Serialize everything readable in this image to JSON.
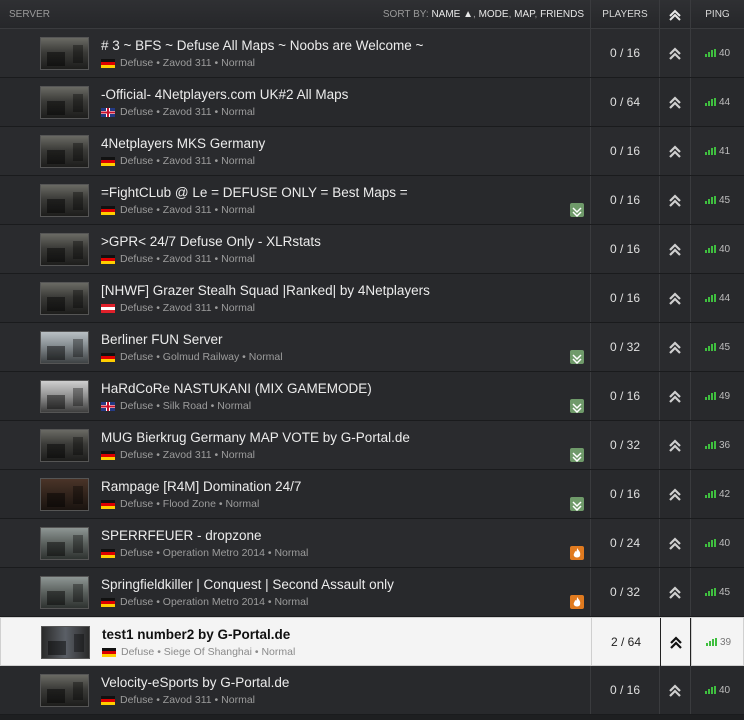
{
  "header": {
    "server": "SERVER",
    "sort_by": "SORT BY:",
    "sort_options": [
      "NAME ▲",
      "MODE",
      "MAP",
      "FRIENDS"
    ],
    "players": "PLAYERS",
    "ping": "PING"
  },
  "colors": {
    "ping_good": "#3fbf3f",
    "selected_bg": "#f4f4f4",
    "badge_green": "#6f9a6a",
    "badge_orange": "#e07a1f"
  },
  "servers": [
    {
      "name": "# 3 ~ BFS ~ Defuse All Maps ~ Noobs are Welcome ~",
      "country": "de",
      "mode": "Defuse",
      "map": "Zavod 311",
      "preset": "Normal",
      "players": "0 / 16",
      "ping": "40",
      "badge": ""
    },
    {
      "name": "-Official- 4Netplayers.com UK#2 All Maps",
      "country": "uk",
      "mode": "Defuse",
      "map": "Zavod 311",
      "preset": "Normal",
      "players": "0 / 64",
      "ping": "44",
      "badge": ""
    },
    {
      "name": "4Netplayers MKS Germany",
      "country": "de",
      "mode": "Defuse",
      "map": "Zavod 311",
      "preset": "Normal",
      "players": "0 / 16",
      "ping": "41",
      "badge": ""
    },
    {
      "name": "=FightCLub @ Le = DEFUSE ONLY = Best Maps =",
      "country": "de",
      "mode": "Defuse",
      "map": "Zavod 311",
      "preset": "Normal",
      "players": "0 / 16",
      "ping": "45",
      "badge": "green"
    },
    {
      "name": ">GPR< 24/7 Defuse Only - XLRstats",
      "country": "de",
      "mode": "Defuse",
      "map": "Zavod 311",
      "preset": "Normal",
      "players": "0 / 16",
      "ping": "40",
      "badge": ""
    },
    {
      "name": "[NHWF] Grazer Stealh Squad |Ranked| by 4Netplayers",
      "country": "at",
      "mode": "Defuse",
      "map": "Zavod 311",
      "preset": "Normal",
      "players": "0 / 16",
      "ping": "44",
      "badge": ""
    },
    {
      "name": "Berliner FUN Server",
      "country": "de",
      "mode": "Defuse",
      "map": "Golmud Railway",
      "preset": "Normal",
      "players": "0 / 32",
      "ping": "45",
      "badge": "green"
    },
    {
      "name": "HaRdCoRe NASTUKANI (MIX GAMEMODE)",
      "country": "uk",
      "mode": "Defuse",
      "map": "Silk Road",
      "preset": "Normal",
      "players": "0 / 16",
      "ping": "49",
      "badge": "green"
    },
    {
      "name": "MUG Bierkrug Germany MAP VOTE by G-Portal.de",
      "country": "de",
      "mode": "Defuse",
      "map": "Zavod 311",
      "preset": "Normal",
      "players": "0 / 32",
      "ping": "36",
      "badge": "green"
    },
    {
      "name": "Rampage [R4M] Domination 24/7",
      "country": "de",
      "mode": "Defuse",
      "map": "Flood Zone",
      "preset": "Normal",
      "players": "0 / 16",
      "ping": "42",
      "badge": "green"
    },
    {
      "name": "SPERRFEUER - dropzone",
      "country": "de",
      "mode": "Defuse",
      "map": "Operation Metro 2014",
      "preset": "Normal",
      "players": "0 / 24",
      "ping": "40",
      "badge": "orange"
    },
    {
      "name": "Springfieldkiller | Conquest | Second Assault only",
      "country": "de",
      "mode": "Defuse",
      "map": "Operation Metro 2014",
      "preset": "Normal",
      "players": "0 / 32",
      "ping": "45",
      "badge": "orange"
    },
    {
      "name": "test1 number2 by G-Portal.de",
      "country": "de",
      "mode": "Defuse",
      "map": "Siege Of Shanghai",
      "preset": "Normal",
      "players": "2 / 64",
      "ping": "39",
      "badge": "",
      "selected": true
    },
    {
      "name": "Velocity-eSports by G-Portal.de",
      "country": "de",
      "mode": "Defuse",
      "map": "Zavod 311",
      "preset": "Normal",
      "players": "0 / 16",
      "ping": "40",
      "badge": ""
    }
  ]
}
